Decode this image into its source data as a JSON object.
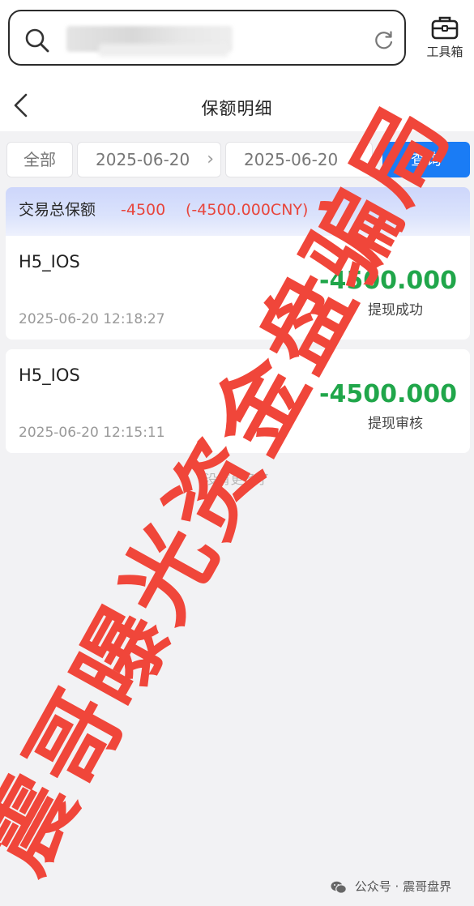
{
  "header": {
    "toolbox_label": "工具箱"
  },
  "nav": {
    "title": "保额明细"
  },
  "filters": {
    "all_label": "全部",
    "start_date": "2025-06-20",
    "end_date": "2025-06-20",
    "query_label": "查询",
    "chevron": "›"
  },
  "summary": {
    "label": "交易总保额",
    "amount": "-4500",
    "cny": "(-4500.000CNY)"
  },
  "records": [
    {
      "source": "H5_IOS",
      "amount": "-4500.000",
      "status": "提现成功",
      "time": "2025-06-20 12:18:27"
    },
    {
      "source": "H5_IOS",
      "amount": "-4500.000",
      "status": "提现审核",
      "time": "2025-06-20 12:15:11"
    }
  ],
  "list_end_text": "没有更多了",
  "watermark_text": "震哥曝光资金盘骗局",
  "footer": {
    "credit": "公众号 · 震哥盘界"
  },
  "colors": {
    "accent": "#1a7cf5",
    "negative": "#e8453c",
    "amount_green": "#20a64a",
    "watermark_red": "#f0463a"
  },
  "icons": {
    "search": "search-icon",
    "refresh": "refresh-icon",
    "toolbox": "toolbox-icon",
    "back": "back-chevron-icon",
    "wechat": "wechat-icon"
  }
}
